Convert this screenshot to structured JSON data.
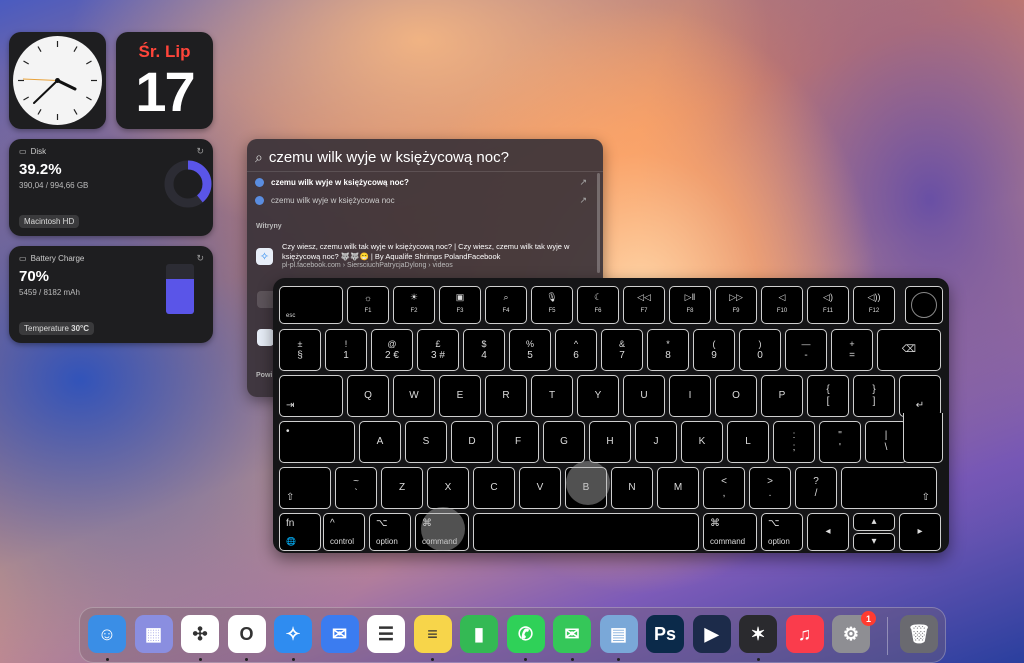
{
  "widgets": {
    "calendar": {
      "weekday": "Śr. Lip",
      "day": "17"
    },
    "disk": {
      "title": "Disk",
      "percent": "39.2%",
      "detail": "390,04 / 994,66 GB",
      "volume": "Macintosh HD",
      "used_fraction": 0.392
    },
    "battery": {
      "title": "Battery Charge",
      "percent": "70%",
      "detail": "5459 / 8182 mAh",
      "temp_label": "Temperature",
      "temp_value": "30°C",
      "level_fraction": 0.7
    }
  },
  "spotlight": {
    "query": "czemu wilk wyje w księżycową noc?",
    "suggestions": [
      "czemu wilk wyje w księżycową noc?",
      "czemu wilk wyje w księżycowa noc"
    ],
    "section_websites": "Witryny",
    "website": {
      "title": "Czy wiesz, czemu wilk tak wyje w księżycową noc? | Czy wiesz, czemu wilk tak wyje w księżycową noc? 🐺🐺😁 | By Aqualife Shrimps PolandFacebook",
      "url": "pl-pl.facebook.com › SiersciuchPatrycjaDylong › videos"
    },
    "section_partial": "Powi"
  },
  "keyboard": {
    "fn_row": [
      {
        "icon": "",
        "label": "esc"
      },
      {
        "icon": "☼",
        "label": "F1"
      },
      {
        "icon": "☀",
        "label": "F2"
      },
      {
        "icon": "▣",
        "label": "F3"
      },
      {
        "icon": "⌕",
        "label": "F4"
      },
      {
        "icon": "🎙",
        "label": "F5"
      },
      {
        "icon": "☾",
        "label": "F6"
      },
      {
        "icon": "◁◁",
        "label": "F7"
      },
      {
        "icon": "▷‖",
        "label": "F8"
      },
      {
        "icon": "▷▷",
        "label": "F9"
      },
      {
        "icon": "◁",
        "label": "F10"
      },
      {
        "icon": "◁)",
        "label": "F11"
      },
      {
        "icon": "◁))",
        "label": "F12"
      }
    ],
    "num_row": [
      {
        "t": "±",
        "b": "§"
      },
      {
        "t": "!",
        "b": "1"
      },
      {
        "t": "@",
        "b": "2 €"
      },
      {
        "t": "£",
        "b": "3 #"
      },
      {
        "t": "$",
        "b": "4"
      },
      {
        "t": "%",
        "b": "5"
      },
      {
        "t": "^",
        "b": "6"
      },
      {
        "t": "&",
        "b": "7"
      },
      {
        "t": "*",
        "b": "8"
      },
      {
        "t": "(",
        "b": "9"
      },
      {
        "t": ")",
        "b": "0"
      },
      {
        "t": "—",
        "b": "-"
      },
      {
        "t": "+",
        "b": "="
      },
      {
        "t": "",
        "b": "⌫"
      }
    ],
    "q_row": [
      "⇥",
      "Q",
      "W",
      "E",
      "R",
      "T",
      "Y",
      "U",
      "I",
      "O",
      "P",
      "{\n[",
      "}\n]",
      "↵"
    ],
    "a_row": [
      "•",
      "A",
      "S",
      "D",
      "F",
      "G",
      "H",
      "J",
      "K",
      "L",
      ":\n;",
      "\"\n'",
      "|\n\\"
    ],
    "z_row": [
      "⇧",
      "~\n`",
      "Z",
      "X",
      "C",
      "V",
      "B",
      "N",
      "M",
      "<\n,",
      ">\n.",
      "?\n/",
      "⇧"
    ],
    "bottom_row": [
      {
        "sym": "fn",
        "label": "🌐"
      },
      {
        "sym": "^",
        "label": "control"
      },
      {
        "sym": "⌥",
        "label": "option"
      },
      {
        "sym": "⌘",
        "label": "command"
      },
      {
        "sym": "",
        "label": ""
      },
      {
        "sym": "⌘",
        "label": "command"
      },
      {
        "sym": "⌥",
        "label": "option"
      },
      {
        "sym": "◂",
        "label": ""
      },
      {
        "sym": "▴",
        "label": ""
      },
      {
        "sym": "▾",
        "label": ""
      },
      {
        "sym": "▸",
        "label": ""
      }
    ]
  },
  "dock": {
    "items": [
      {
        "name": "finder",
        "glyph": "☺",
        "color": "#3a8ee6",
        "running": true
      },
      {
        "name": "launchpad",
        "glyph": "▦",
        "color": "#8a8ee0",
        "running": false
      },
      {
        "name": "chatgpt",
        "glyph": "✣",
        "color": "#ffffff",
        "running": true
      },
      {
        "name": "opera",
        "glyph": "O",
        "color": "#ffffff",
        "running": true
      },
      {
        "name": "safari",
        "glyph": "✧",
        "color": "#2f8cf0",
        "running": true
      },
      {
        "name": "mail",
        "glyph": "✉",
        "color": "#3b7cf0",
        "running": false
      },
      {
        "name": "reminders",
        "glyph": "☰",
        "color": "#ffffff",
        "running": false
      },
      {
        "name": "notes",
        "glyph": "≡",
        "color": "#f7d54a",
        "running": true
      },
      {
        "name": "numbers",
        "glyph": "▮",
        "color": "#34b954",
        "running": false
      },
      {
        "name": "whatsapp",
        "glyph": "✆",
        "color": "#2fd158",
        "running": true
      },
      {
        "name": "messages",
        "glyph": "✉",
        "color": "#35c759",
        "running": true
      },
      {
        "name": "preview",
        "glyph": "▤",
        "color": "#7aa8d8",
        "running": true
      },
      {
        "name": "photoshop",
        "glyph": "Ps",
        "color": "#0b2a4a",
        "running": false
      },
      {
        "name": "infuse",
        "glyph": "▶",
        "color": "#1c2b4a",
        "running": false
      },
      {
        "name": "final-cut-pro",
        "glyph": "✶",
        "color": "#2a2a2e",
        "running": true
      },
      {
        "name": "music",
        "glyph": "♫",
        "color": "#fa3c4c",
        "running": false
      },
      {
        "name": "system-settings",
        "glyph": "⚙",
        "color": "#8e8e93",
        "running": false,
        "badge": "1"
      },
      {
        "name": "trash",
        "glyph": "🗑",
        "color": "#6a6a70",
        "running": false
      }
    ]
  }
}
